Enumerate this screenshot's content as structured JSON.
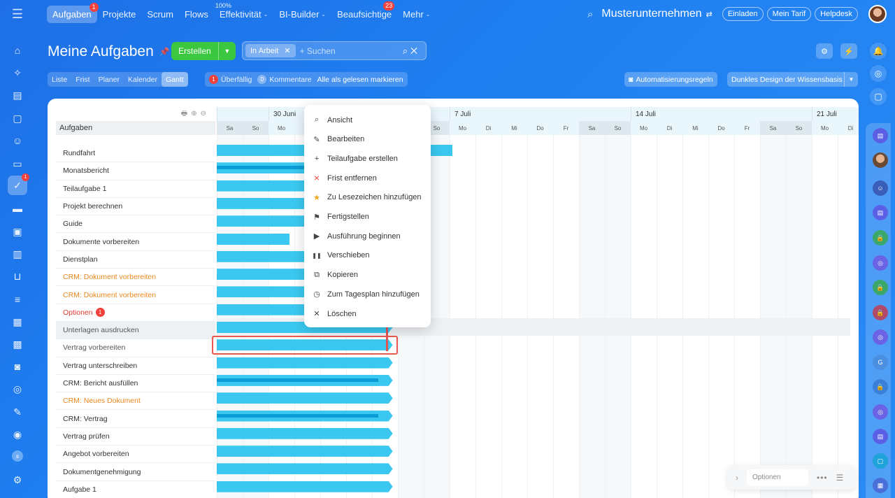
{
  "topbar": {
    "nav": [
      {
        "label": "Aufgaben",
        "active": true,
        "badge": "1"
      },
      {
        "label": "Projekte"
      },
      {
        "label": "Scrum"
      },
      {
        "label": "Flows"
      },
      {
        "label": "Effektivität",
        "caret": true,
        "sup": "100%"
      },
      {
        "label": "BI-Builder",
        "caret": true
      },
      {
        "label": "Beaufsichtige",
        "badge": "23"
      },
      {
        "label": "Mehr",
        "caret": true
      }
    ],
    "company": "Musterunternehmen",
    "buttons": [
      "Einladen",
      "Mein Tarif",
      "Helpdesk"
    ]
  },
  "header": {
    "title": "Meine Aufgaben",
    "create_label": "Erstellen",
    "filter_chip": "In Arbeit",
    "search_placeholder": "+ Suchen"
  },
  "views": {
    "tabs": [
      "Liste",
      "Frist",
      "Planer",
      "Kalender",
      "Gantt"
    ],
    "active": "Gantt",
    "overdue_count": "1",
    "overdue_label": "Überfällig",
    "comments_count": "0",
    "comments_label": "Kommentare",
    "mark_read_label": "Alle als gelesen markieren",
    "automation_label": "Automatisierungsregeln",
    "theme_label": "Dunkles Design der Wissensbasis"
  },
  "tasklist": {
    "header": "Aufgaben",
    "tasks": [
      {
        "label": "Rundfahrt"
      },
      {
        "label": "Monatsbericht"
      },
      {
        "label": "Teilaufgabe 1"
      },
      {
        "label": "Projekt berechnen"
      },
      {
        "label": "Guide"
      },
      {
        "label": "Dokumente vorbereiten"
      },
      {
        "label": "Dienstplan"
      },
      {
        "label": "CRM: Dokument vorbereiten",
        "color": "orange"
      },
      {
        "label": "CRM: Dokument vorbereiten",
        "color": "orange"
      },
      {
        "label": "Optionen",
        "color": "red",
        "badge": "1"
      },
      {
        "label": "Unterlagen ausdrucken",
        "color": "gray",
        "selected": true
      },
      {
        "label": "Vertrag vorbereiten",
        "color": "gray"
      },
      {
        "label": "Vertrag unterschreiben"
      },
      {
        "label": "CRM: Bericht ausfüllen"
      },
      {
        "label": "CRM: Neues Dokument",
        "color": "orange"
      },
      {
        "label": "CRM: Vertrag"
      },
      {
        "label": "Vertrag prüfen"
      },
      {
        "label": "Angebot vorbereiten"
      },
      {
        "label": "Dokumentgenehmigung"
      },
      {
        "label": "Aufgabe 1"
      }
    ]
  },
  "gantt": {
    "weeks": [
      "30 Juni",
      "7 Juli",
      "14 Juli",
      "21 Juli"
    ],
    "days": [
      "Sa",
      "So",
      "Mo",
      "Di",
      "Mi",
      "Do",
      "Fr",
      "Sa",
      "So",
      "Mo",
      "Di",
      "Mi",
      "Do",
      "Fr",
      "Sa",
      "So",
      "Mo",
      "Di",
      "Mi",
      "Do",
      "Fr",
      "Sa",
      "So",
      "Mo",
      "Di"
    ],
    "bars": [
      {
        "days": 9.1,
        "arrow": false,
        "progress": 0
      },
      {
        "days": 6.8,
        "arrow": true,
        "progress": 0.9
      },
      {
        "days": 6.8,
        "arrow": true,
        "progress": 0
      },
      {
        "days": 6.8,
        "arrow": true,
        "progress": 0
      },
      {
        "days": 6.8,
        "arrow": true,
        "progress": 0
      },
      {
        "days": 2.8,
        "arrow": false,
        "progress": 0
      },
      {
        "days": 6.8,
        "arrow": true,
        "progress": 0
      },
      {
        "days": 6.8,
        "arrow": true,
        "progress": 0
      },
      {
        "days": 6.8,
        "arrow": true,
        "progress": 0
      },
      {
        "days": 6.8,
        "arrow": true,
        "progress": 0
      },
      {
        "days": 6.8,
        "arrow": true,
        "progress": 0
      },
      {
        "days": 6.8,
        "arrow": true,
        "progress": 0
      },
      {
        "days": 6.8,
        "arrow": true,
        "progress": 0
      },
      {
        "days": 6.8,
        "arrow": true,
        "progress": 0.92
      },
      {
        "days": 6.8,
        "arrow": true,
        "progress": 0
      },
      {
        "days": 6.8,
        "arrow": true,
        "progress": 0.92
      },
      {
        "days": 6.8,
        "arrow": true,
        "progress": 0
      },
      {
        "days": 6.8,
        "arrow": true,
        "progress": 0
      },
      {
        "days": 6.8,
        "arrow": true,
        "progress": 0
      },
      {
        "days": 6.8,
        "arrow": true,
        "progress": 0
      }
    ]
  },
  "context_menu": {
    "items": [
      {
        "label": "Ansicht",
        "icon": "search-icon"
      },
      {
        "label": "Bearbeiten",
        "icon": "pencil-icon"
      },
      {
        "label": "Teilaufgabe erstellen",
        "icon": "plus-icon"
      },
      {
        "label": "Frist entfernen",
        "icon": "remove-deadline-icon"
      },
      {
        "label": "Zu Lesezeichen hinzufügen",
        "icon": "star-icon"
      },
      {
        "label": "Fertigstellen",
        "icon": "flag-icon"
      },
      {
        "label": "Ausführung beginnen",
        "icon": "play-icon"
      },
      {
        "label": "Verschieben",
        "icon": "pause-icon"
      },
      {
        "label": "Kopieren",
        "icon": "copy-icon"
      },
      {
        "label": "Zum Tagesplan hinzufügen",
        "icon": "clock-icon"
      },
      {
        "label": "Löschen",
        "icon": "close-icon"
      }
    ]
  },
  "options_widget": {
    "placeholder": "Optionen"
  },
  "colors": {
    "accent": "#3bc73f",
    "bar": "#3bc8f0",
    "bar_progress": "#0b9ed6",
    "highlight": "#e8594f"
  }
}
